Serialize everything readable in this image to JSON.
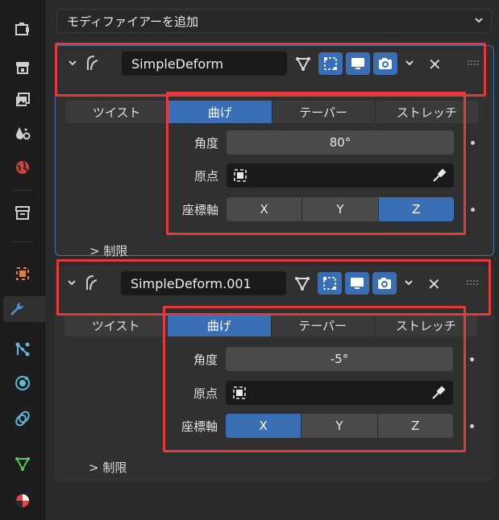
{
  "sidebar": {
    "icons": [
      "tool-icon",
      "render-icon",
      "output-icon",
      "view-layer-icon",
      "scene-icon",
      "world-icon",
      "collection-icon",
      "object-icon",
      "modifier-wrench-icon",
      "particles-icon",
      "physics-icon",
      "constraints-icon",
      "data-icon",
      "material-icon"
    ]
  },
  "add_modifier": {
    "label": "モディファイアーを追加"
  },
  "modifiers": [
    {
      "name": "SimpleDeform",
      "tabs": [
        "ツイスト",
        "曲げ",
        "テーパー",
        "ストレッチ"
      ],
      "active_tab": 1,
      "angle_label": "角度",
      "angle_value": "80°",
      "origin_label": "原点",
      "axis_label": "座標軸",
      "axes": [
        "X",
        "Y",
        "Z"
      ],
      "active_axis": 2,
      "limits_label": "制限"
    },
    {
      "name": "SimpleDeform.001",
      "tabs": [
        "ツイスト",
        "曲げ",
        "テーパー",
        "ストレッチ"
      ],
      "active_tab": 1,
      "angle_label": "角度",
      "angle_value": "-5°",
      "origin_label": "原点",
      "axis_label": "座標軸",
      "axes": [
        "X",
        "Y",
        "Z"
      ],
      "active_axis": 0,
      "limits_label": "制限"
    }
  ],
  "colors": {
    "accent": "#3b6fb5",
    "highlight_box": "#e23b3b"
  }
}
